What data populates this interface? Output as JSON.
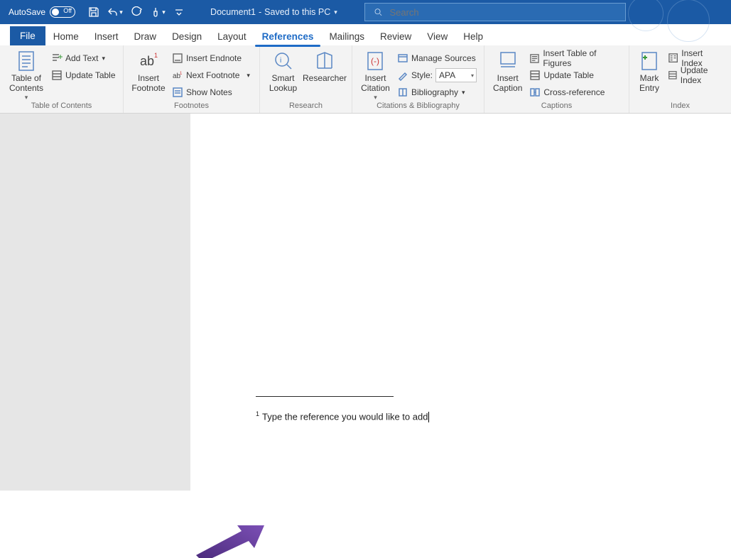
{
  "titlebar": {
    "autosave_label": "AutoSave",
    "autosave_state": "Off",
    "doc_name": "Document1",
    "doc_status": "Saved to this PC",
    "search_placeholder": "Search"
  },
  "tabs": {
    "file": "File",
    "home": "Home",
    "insert": "Insert",
    "draw": "Draw",
    "design": "Design",
    "layout": "Layout",
    "references": "References",
    "mailings": "Mailings",
    "review": "Review",
    "view": "View",
    "help": "Help"
  },
  "ribbon": {
    "toc_group": "Table of Contents",
    "toc_btn": "Table of\nContents",
    "add_text": "Add Text",
    "update_table": "Update Table",
    "footnotes_group": "Footnotes",
    "insert_footnote": "Insert\nFootnote",
    "insert_endnote": "Insert Endnote",
    "next_footnote": "Next Footnote",
    "show_notes": "Show Notes",
    "research_group": "Research",
    "smart_lookup": "Smart\nLookup",
    "researcher": "Researcher",
    "citations_group": "Citations & Bibliography",
    "insert_citation": "Insert\nCitation",
    "manage_sources": "Manage Sources",
    "style_label": "Style:",
    "style_value": "APA",
    "bibliography": "Bibliography",
    "captions_group": "Captions",
    "insert_caption": "Insert\nCaption",
    "insert_tof": "Insert Table of Figures",
    "update_table2": "Update Table",
    "cross_reference": "Cross-reference",
    "index_group": "Index",
    "mark_entry": "Mark\nEntry",
    "insert_index": "Insert Index",
    "update_index": "Update Index"
  },
  "doc": {
    "footnote_num": "1",
    "footnote_text": "Type the reference you would like to add"
  }
}
